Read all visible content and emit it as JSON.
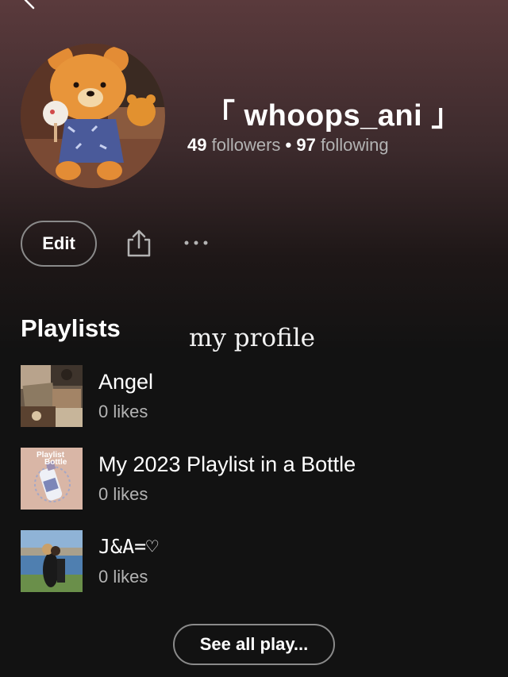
{
  "profile": {
    "name": "「 whoops_ani 」",
    "followers_count": "49",
    "followers_label": "followers",
    "separator": "•",
    "following_count": "97",
    "following_label": "following"
  },
  "actions": {
    "edit_label": "Edit",
    "share_icon": "share-icon",
    "more_icon": "more-icon"
  },
  "playlists": {
    "section_title": "Playlists",
    "caption": "my profile",
    "items": [
      {
        "title": "Angel",
        "likes": "0 likes"
      },
      {
        "title": "My 2023 Playlist in a Bottle",
        "likes": "0 likes",
        "thumb_text_1": "Playlist",
        "thumb_text_2": "Bottle"
      },
      {
        "title": "J&A=♡",
        "likes": "0 likes"
      }
    ],
    "see_all_label": "See all play..."
  }
}
